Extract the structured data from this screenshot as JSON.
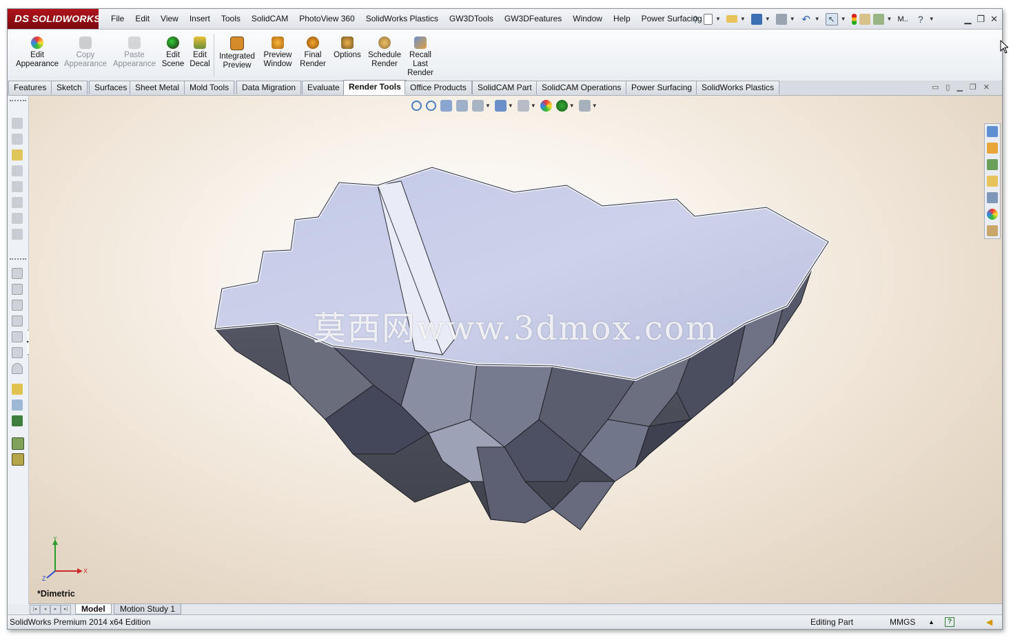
{
  "app": {
    "logo_text": "SOLIDWORKS",
    "logo_mark": "DS",
    "menus": [
      "File",
      "Edit",
      "View",
      "Insert",
      "Tools",
      "SolidCAM",
      "PhotoView 360",
      "SolidWorks Plastics",
      "GW3DTools",
      "GW3DFeatures",
      "Window",
      "Help",
      "Power Surfacing"
    ],
    "quick_label": "M.."
  },
  "commands": [
    {
      "label1": "Edit",
      "label2": "Appearance",
      "enabled": true
    },
    {
      "label1": "Copy",
      "label2": "Appearance",
      "enabled": false
    },
    {
      "label1": "Paste",
      "label2": "Appearance",
      "enabled": false
    },
    {
      "label1": "Edit",
      "label2": "Scene",
      "enabled": true
    },
    {
      "label1": "Edit",
      "label2": "Decal",
      "enabled": true
    },
    {
      "label1": "Integrated",
      "label2": "Preview",
      "enabled": true
    },
    {
      "label1": "Preview",
      "label2": "Window",
      "enabled": true
    },
    {
      "label1": "Final",
      "label2": "Render",
      "enabled": true
    },
    {
      "label1": "Options",
      "label2": "",
      "enabled": true
    },
    {
      "label1": "Schedule",
      "label2": "Render",
      "enabled": true
    },
    {
      "label1": "Recall",
      "label2": "Last",
      "label3": "Render",
      "enabled": true
    }
  ],
  "tabs": [
    "Features",
    "Sketch",
    "Surfaces",
    "Sheet Metal",
    "Mold Tools",
    "Data Migration",
    "Evaluate",
    "Render Tools",
    "Office Products",
    "SolidCAM Part",
    "SolidCAM Operations",
    "Power Surfacing",
    "SolidWorks Plastics"
  ],
  "active_tab": "Render Tools",
  "viewport": {
    "view_name": "*Dimetric",
    "watermark": "莫西网www.3dmox.com",
    "triad": {
      "x": "X",
      "y": "Y",
      "z": "Z"
    }
  },
  "bottom_tabs": [
    "Model",
    "Motion Study 1"
  ],
  "active_bottom_tab": "Model",
  "status": {
    "edition": "SolidWorks Premium 2014 x64 Edition",
    "mode": "Editing Part",
    "units": "MMGS",
    "arrow": "▲",
    "help": "?"
  },
  "colors": {
    "logo_red": "#9a0f17",
    "model_top": "#c7cde6",
    "model_side": "#4a4c57"
  }
}
